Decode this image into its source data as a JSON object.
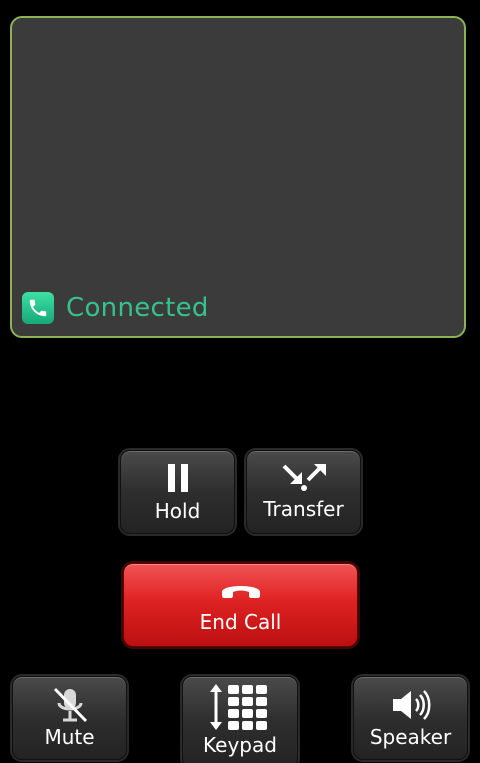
{
  "call": {
    "status_label": "Connected",
    "status_color": "#35c28f",
    "card_border_color": "#8db255",
    "status_icon": "phone-icon"
  },
  "controls": {
    "hold": {
      "label": "Hold",
      "icon": "pause-icon"
    },
    "transfer": {
      "label": "Transfer",
      "icon": "transfer-arrows-icon"
    },
    "end_call": {
      "label": "End Call",
      "icon": "hangup-icon",
      "color": "#de2222"
    },
    "mute": {
      "label": "Mute",
      "icon": "microphone-muted-icon"
    },
    "keypad": {
      "label": "Keypad",
      "icon": "dialpad-icon"
    },
    "speaker": {
      "label": "Speaker",
      "icon": "speaker-icon"
    }
  }
}
